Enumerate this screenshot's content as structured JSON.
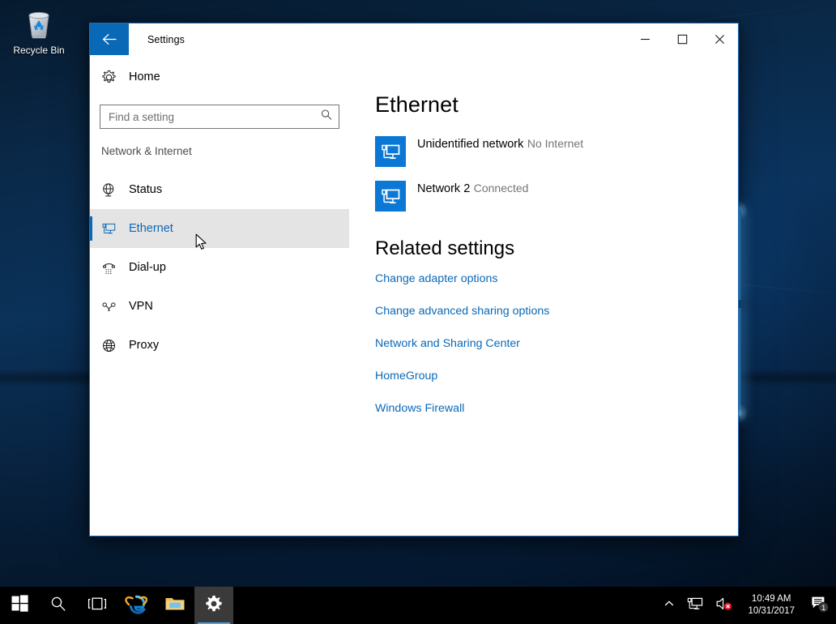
{
  "desktop": {
    "recycle_bin": {
      "label": "Recycle Bin",
      "icon": "recycle-bin-icon"
    }
  },
  "window": {
    "title": "Settings",
    "back_icon": "back-arrow-icon",
    "controls": {
      "minimize": "minimize-icon",
      "maximize": "maximize-icon",
      "close": "close-icon"
    },
    "accent_color": "#0a69b7",
    "border_color": "#1e6fbe"
  },
  "sidebar": {
    "home": {
      "label": "Home",
      "icon": "gear-icon"
    },
    "search": {
      "placeholder": "Find a setting",
      "value": "",
      "icon": "search-icon"
    },
    "category": "Network & Internet",
    "items": [
      {
        "label": "Status",
        "icon": "globe-status-icon",
        "selected": false
      },
      {
        "label": "Ethernet",
        "icon": "ethernet-icon",
        "selected": true
      },
      {
        "label": "Dial-up",
        "icon": "dialup-icon",
        "selected": false
      },
      {
        "label": "VPN",
        "icon": "vpn-key-icon",
        "selected": false
      },
      {
        "label": "Proxy",
        "icon": "globe-icon",
        "selected": false
      }
    ]
  },
  "content": {
    "heading": "Ethernet",
    "adapters": [
      {
        "name": "Unidentified network",
        "status": "No Internet",
        "icon": "network-pc-icon"
      },
      {
        "name": "Network  2",
        "status": "Connected",
        "icon": "network-pc-icon"
      }
    ],
    "related_heading": "Related settings",
    "related_links": [
      "Change adapter options",
      "Change advanced sharing options",
      "Network and Sharing Center",
      "HomeGroup",
      "Windows Firewall"
    ],
    "link_color": "#0a69b7"
  },
  "taskbar": {
    "buttons": [
      {
        "name": "start-button",
        "icon": "windows-logo-icon",
        "active": false
      },
      {
        "name": "search-button",
        "icon": "search-icon",
        "active": false
      },
      {
        "name": "task-view-button",
        "icon": "task-view-icon",
        "active": false
      },
      {
        "name": "internet-explorer-button",
        "icon": "internet-explorer-icon",
        "active": false
      },
      {
        "name": "file-explorer-button",
        "icon": "folder-icon",
        "active": false
      },
      {
        "name": "settings-button",
        "icon": "gear-icon",
        "active": true
      }
    ],
    "tray": [
      {
        "name": "show-hidden-icons",
        "icon": "chevron-up-icon"
      },
      {
        "name": "network-tray-icon",
        "icon": "network-pc-icon"
      },
      {
        "name": "volume-tray-icon",
        "icon": "speaker-muted-icon"
      }
    ],
    "clock": {
      "time": "10:49 AM",
      "date": "10/31/2017"
    },
    "action_center": {
      "icon": "notification-icon",
      "badge": "1"
    }
  }
}
